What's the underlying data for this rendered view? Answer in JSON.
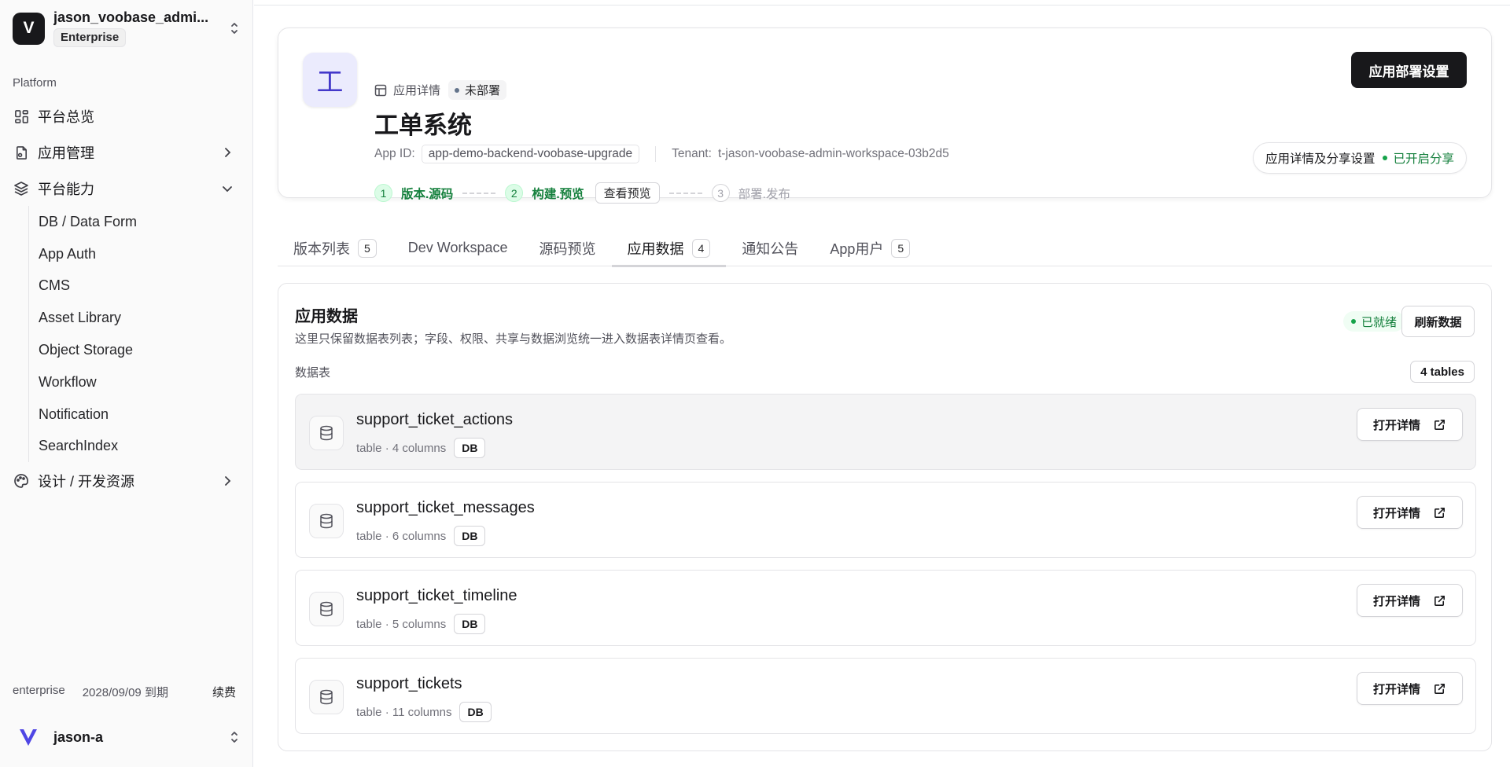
{
  "workspace": {
    "logo_letter": "V",
    "name": "jason_voobase_admi...",
    "plan_badge": "Enterprise"
  },
  "sidebar": {
    "section_label": "Platform",
    "items": [
      {
        "label": "平台总览",
        "icon": "dashboard-grid-icon"
      },
      {
        "label": "应用管理",
        "icon": "app-doc-icon"
      },
      {
        "label": "平台能力",
        "icon": "layers-icon"
      }
    ],
    "sub_items": [
      "DB / Data Form",
      "App Auth",
      "CMS",
      "Asset Library",
      "Object Storage",
      "Workflow",
      "Notification",
      "SearchIndex"
    ],
    "design_item": {
      "label": "设计 / 开发资源",
      "icon": "palette-icon"
    },
    "footer": {
      "plan": "enterprise",
      "expiry": "2028/09/09 到期",
      "renew": "续费"
    },
    "user": {
      "name": "jason-a"
    }
  },
  "app": {
    "icon_char": "工",
    "crumb_label": "应用详情",
    "status": "未部署",
    "title": "工单系统",
    "app_id_label": "App ID:",
    "app_id": "app-demo-backend-voobase-upgrade",
    "tenant_label": "Tenant:",
    "tenant": "t-jason-voobase-admin-workspace-03b2d5",
    "deploy_button": "应用部署设置",
    "share_button": "应用详情及分享设置",
    "share_status": "已开启分享",
    "steps": [
      {
        "num": "1",
        "label": "版本.源码",
        "state": "done"
      },
      {
        "num": "2",
        "label": "构建.预览",
        "state": "done"
      },
      {
        "num": "3",
        "label": "部署.发布",
        "state": "todo"
      }
    ],
    "preview_button": "查看预览"
  },
  "tabs": [
    {
      "label": "版本列表",
      "count": "5"
    },
    {
      "label": "Dev Workspace",
      "count": null
    },
    {
      "label": "源码预览",
      "count": null
    },
    {
      "label": "应用数据",
      "count": "4",
      "active": true
    },
    {
      "label": "通知公告",
      "count": null
    },
    {
      "label": "App用户",
      "count": "5"
    }
  ],
  "data_panel": {
    "title": "应用数据",
    "description": "这里只保留数据表列表；字段、权限、共享与数据浏览统一进入数据表详情页查看。",
    "ready_status": "已就绪",
    "refresh_button": "刷新数据",
    "tables_label": "数据表",
    "tables_count": "4 tables",
    "tables": [
      {
        "name": "support_ticket_actions",
        "meta": "table · 4 columns",
        "tag": "DB",
        "open": "打开详情"
      },
      {
        "name": "support_ticket_messages",
        "meta": "table · 6 columns",
        "tag": "DB",
        "open": "打开详情"
      },
      {
        "name": "support_ticket_timeline",
        "meta": "table · 5 columns",
        "tag": "DB",
        "open": "打开详情"
      },
      {
        "name": "support_tickets",
        "meta": "table · 11 columns",
        "tag": "DB",
        "open": "打开详情"
      }
    ]
  },
  "colors": {
    "accent_indigo": "#4338ca",
    "success_green": "#15803d",
    "primary_dark": "#18181b"
  }
}
